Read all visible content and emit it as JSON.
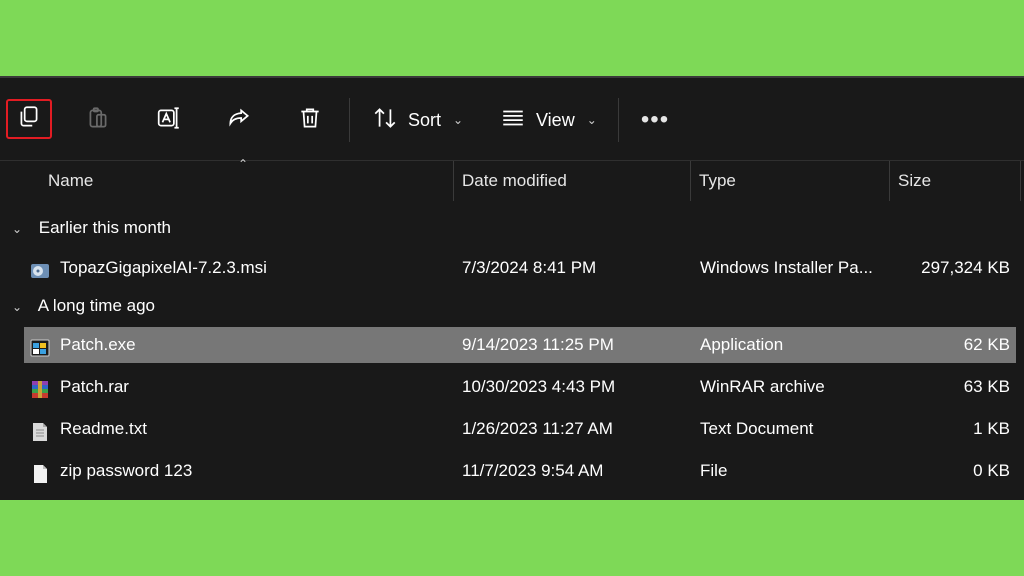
{
  "toolbar": {
    "copy": "copy-icon",
    "paste": "paste-icon",
    "rename": "rename-icon",
    "share": "share-icon",
    "delete": "trash-icon",
    "sort_label": "Sort",
    "view_label": "View",
    "more": "•••"
  },
  "columns": {
    "name": "Name",
    "date": "Date modified",
    "type": "Type",
    "size": "Size"
  },
  "groups": [
    {
      "label": "Earlier this month",
      "files": [
        {
          "name": "TopazGigapixelAI-7.2.3.msi",
          "date": "7/3/2024 8:41 PM",
          "type": "Windows Installer Pa...",
          "size": "297,324 KB",
          "icon": "installer-icon",
          "selected": false
        }
      ]
    },
    {
      "label": "A long time ago",
      "files": [
        {
          "name": "Patch.exe",
          "date": "9/14/2023 11:25 PM",
          "type": "Application",
          "size": "62 KB",
          "icon": "application-icon",
          "selected": true
        },
        {
          "name": "Patch.rar",
          "date": "10/30/2023 4:43 PM",
          "type": "WinRAR archive",
          "size": "63 KB",
          "icon": "winrar-archive-icon",
          "selected": false
        },
        {
          "name": "Readme.txt",
          "date": "1/26/2023 11:27 AM",
          "type": "Text Document",
          "size": "1 KB",
          "icon": "text-document-icon",
          "selected": false
        },
        {
          "name": "zip password 123",
          "date": "11/7/2023 9:54 AM",
          "type": "File",
          "size": "0 KB",
          "icon": "file-icon",
          "selected": false
        }
      ]
    }
  ],
  "colors": {
    "background": "#7ed957",
    "window": "#191919",
    "selection": "#777777",
    "highlight_box": "#e21c23"
  }
}
